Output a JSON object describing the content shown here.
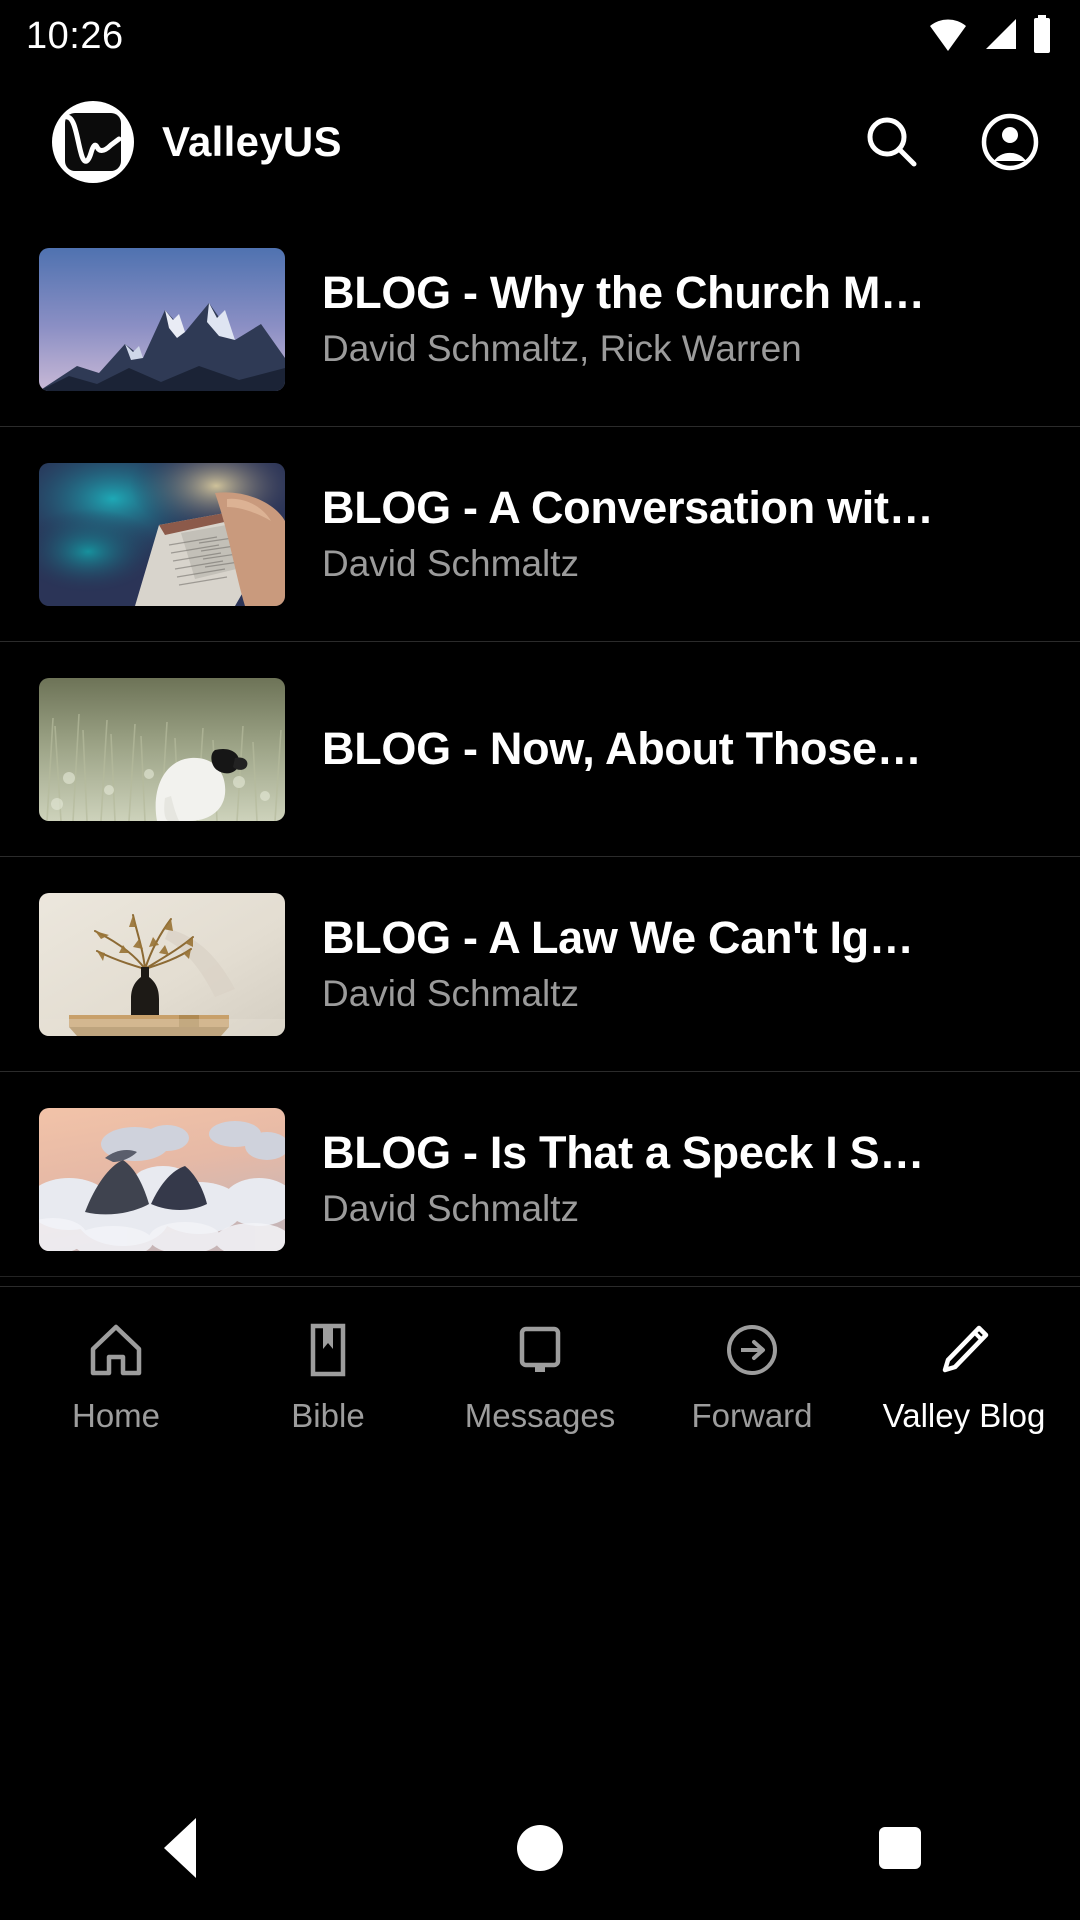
{
  "status_bar": {
    "time": "10:26",
    "icons": [
      "wifi-icon",
      "cellular-signal-icon",
      "battery-icon"
    ]
  },
  "app_bar": {
    "brand_name": "ValleyUS",
    "logo_icon": "valleyus-logo-icon",
    "search_icon": "search-icon",
    "account_icon": "account-circle-icon"
  },
  "blog_list": {
    "items": [
      {
        "title": "BLOG - Why the Church M…",
        "author": "David Schmaltz, Rick Warren",
        "thumbnail": "snowy-mountain-peak-at-dusk"
      },
      {
        "title": "BLOG - A Conversation wit…",
        "author": "David Schmaltz",
        "thumbnail": "hands-holding-open-bible"
      },
      {
        "title": "BLOG - Now, About Those…",
        "author": "",
        "thumbnail": "white-sheep-in-grassy-field"
      },
      {
        "title": "BLOG - A Law We Can't Ig…",
        "author": "David Schmaltz",
        "thumbnail": "dried-palm-in-black-vase-on-wood-shelf"
      },
      {
        "title": "BLOG - Is That a Speck I S…",
        "author": "David Schmaltz",
        "thumbnail": "clouds-above-mountain-at-sunset"
      }
    ]
  },
  "bottom_nav": {
    "active_index": 4,
    "items": [
      {
        "label": "Home",
        "icon": "home-icon"
      },
      {
        "label": "Bible",
        "icon": "book-bookmark-icon"
      },
      {
        "label": "Messages",
        "icon": "monitor-icon"
      },
      {
        "label": "Forward",
        "icon": "arrow-circle-right-icon"
      },
      {
        "label": "Valley Blog",
        "icon": "pencil-icon"
      }
    ]
  },
  "system_nav": {
    "back": "back-triangle-icon",
    "home": "home-circle-icon",
    "recents": "recents-square-icon"
  },
  "colors": {
    "background": "#000000",
    "title_text": "#ffffff",
    "secondary_text": "#9b9b9b",
    "divider": "#2b2b2b",
    "nav_inactive": "#9d9d9d",
    "nav_active": "#ffffff"
  }
}
